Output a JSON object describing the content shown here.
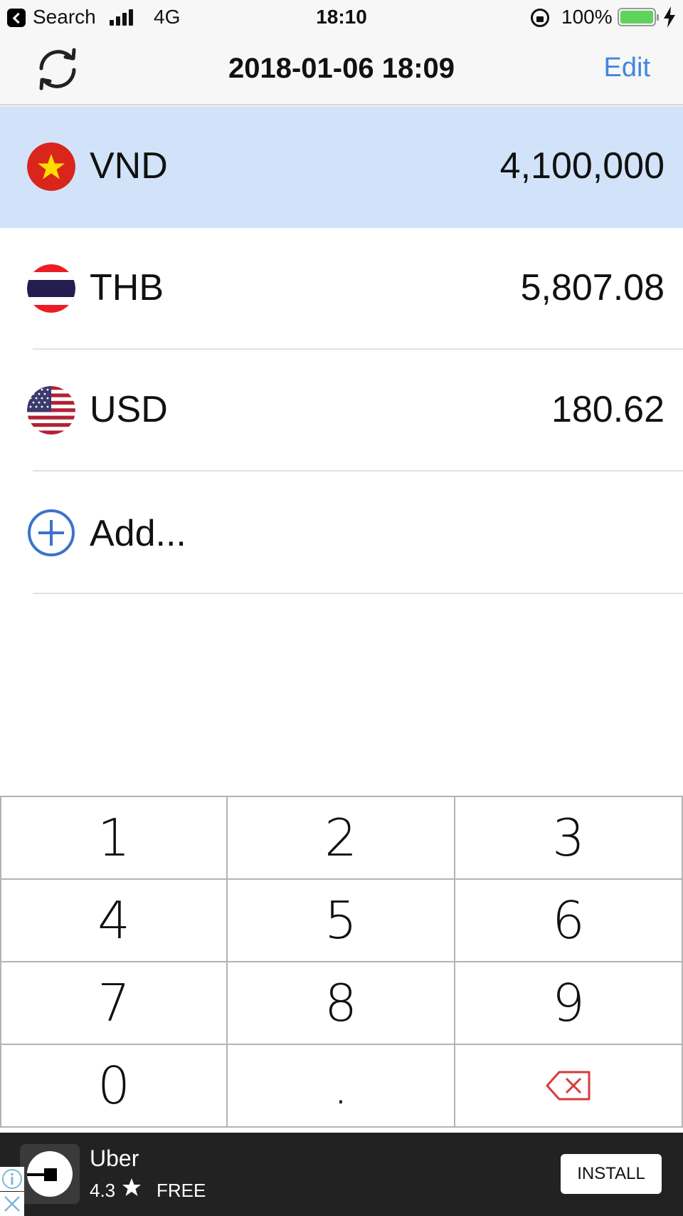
{
  "status_bar": {
    "back_app": "Search",
    "network": "4G",
    "time": "18:10",
    "battery": "100%",
    "battery_level": 1.0
  },
  "nav": {
    "title": "2018-01-06 18:09",
    "edit_label": "Edit"
  },
  "currencies": [
    {
      "code": "VND",
      "amount": "4,100,000",
      "flag": "vietnam-flag-icon",
      "selected": true
    },
    {
      "code": "THB",
      "amount": "5,807.08",
      "flag": "thailand-flag-icon",
      "selected": false
    },
    {
      "code": "USD",
      "amount": "180.62",
      "flag": "usa-flag-icon",
      "selected": false
    }
  ],
  "add_row": {
    "label": "Add..."
  },
  "keypad": {
    "keys": [
      "1",
      "2",
      "3",
      "4",
      "5",
      "6",
      "7",
      "8",
      "9",
      "0",
      ".",
      "backspace-icon"
    ]
  },
  "ad": {
    "app_name": "Uber",
    "rating": "4.3",
    "price": "FREE",
    "install_label": "INSTALL"
  },
  "colors": {
    "accent": "#3f87de",
    "selected_row": "#d2e3f9",
    "backspace": "#d93a3a",
    "battery": "#5fd35b",
    "ad_background": "#222222"
  }
}
